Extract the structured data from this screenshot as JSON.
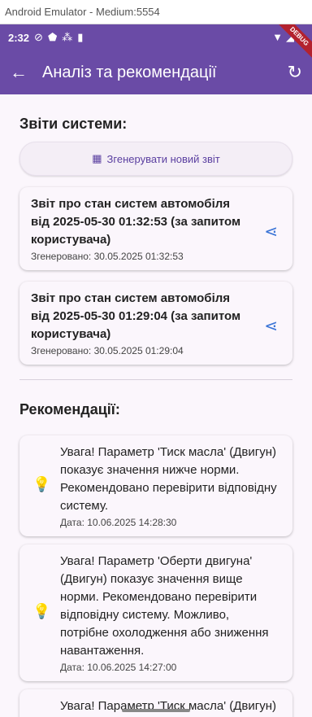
{
  "window": {
    "title": "Android Emulator - Medium:5554"
  },
  "status_bar": {
    "time": "2:32",
    "debug_label": "DEBUG"
  },
  "app_bar": {
    "title": "Аналіз та рекомендації",
    "back_icon": "arrow-back-icon",
    "refresh_icon": "refresh-icon"
  },
  "reports": {
    "heading": "Звіти системи:",
    "generate_label": "Згенерувати новий звіт",
    "items": [
      {
        "title": "Звіт про стан систем автомобіля від 2025-05-30 01:32:53 (за запитом користувача)",
        "generated": "Згенеровано: 30.05.2025 01:32:53"
      },
      {
        "title": "Звіт про стан систем автомобіля від 2025-05-30 01:29:04 (за запитом користувача)",
        "generated": "Згенеровано: 30.05.2025 01:29:04"
      }
    ]
  },
  "recommendations": {
    "heading": "Рекомендації:",
    "items": [
      {
        "text": "Увага! Параметр 'Тиск масла' (Двигун) показує значення нижче норми. Рекомендовано перевірити відповідну систему.",
        "date": "Дата: 10.06.2025 14:28:30"
      },
      {
        "text": "Увага! Параметр 'Оберти двигуна' (Двигун) показує значення вище норми. Рекомендовано перевірити відповідну систему. Можливо, потрібне охолодження або зниження навантаження.",
        "date": "Дата: 10.06.2025 14:27:00"
      },
      {
        "text": "Увага! Параметр 'Тиск масла' (Двигун) показує значення нижче",
        "date": ""
      }
    ]
  },
  "colors": {
    "primary": "#6a4ba6",
    "accent": "#f08c13",
    "share": "#3a74d6"
  }
}
